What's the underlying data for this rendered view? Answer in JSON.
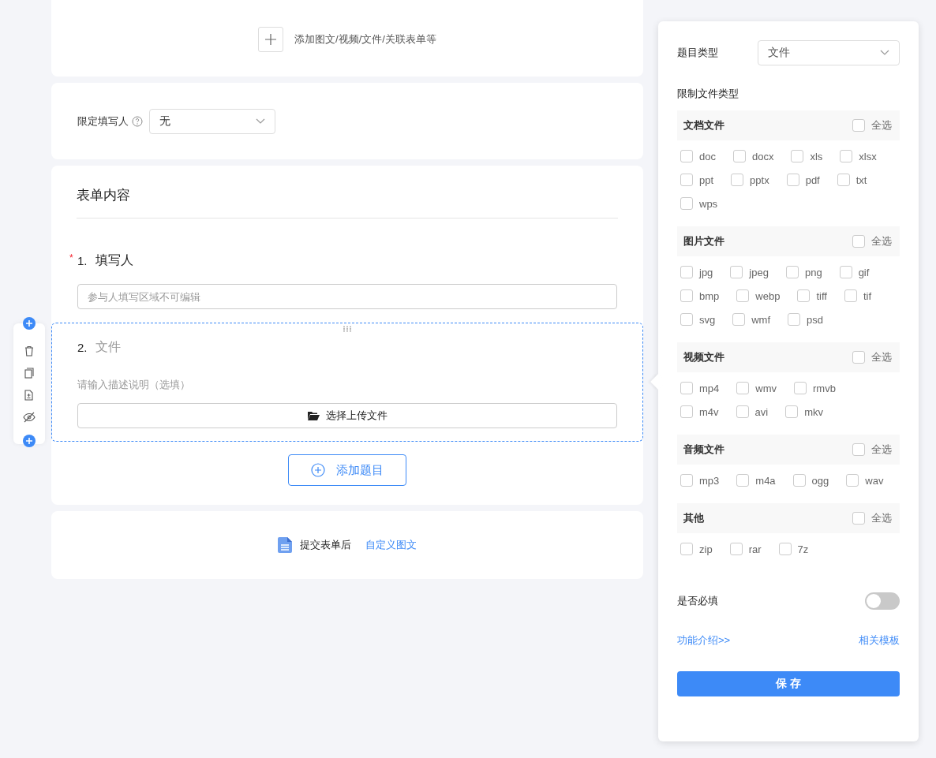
{
  "top_card": {
    "add_label": "添加图文/视频/文件/关联表单等"
  },
  "restrict": {
    "label": "限定填写人",
    "value": "无"
  },
  "form": {
    "title": "表单内容",
    "questions": [
      {
        "kind": "text",
        "number": "1.",
        "title": "填写人",
        "required_mark": "*",
        "placeholder": "参与人填写区域不可编辑",
        "selected": false
      },
      {
        "kind": "file",
        "number": "2.",
        "title": "文件",
        "description": "请输入描述说明（选填）",
        "upload_label": "选择上传文件",
        "selected": true
      }
    ],
    "add_button": "添加题目"
  },
  "after_submit": {
    "label": "提交表单后",
    "link": "自定义图文"
  },
  "panel": {
    "type_label": "题目类型",
    "type_value": "文件",
    "restrict_label": "限制文件类型",
    "groups": [
      {
        "title": "文档文件",
        "all_label": "全选",
        "all_checked": false,
        "items": [
          {
            "label": "doc",
            "checked": false
          },
          {
            "label": "docx",
            "checked": false
          },
          {
            "label": "xls",
            "checked": false
          },
          {
            "label": "xlsx",
            "checked": false
          },
          {
            "label": "ppt",
            "checked": false
          },
          {
            "label": "pptx",
            "checked": false
          },
          {
            "label": "pdf",
            "checked": false
          },
          {
            "label": "txt",
            "checked": false
          },
          {
            "label": "wps",
            "checked": false
          }
        ]
      },
      {
        "title": "图片文件",
        "all_label": "全选",
        "all_checked": false,
        "items": [
          {
            "label": "jpg",
            "checked": false
          },
          {
            "label": "jpeg",
            "checked": false
          },
          {
            "label": "png",
            "checked": false
          },
          {
            "label": "gif",
            "checked": false
          },
          {
            "label": "bmp",
            "checked": false
          },
          {
            "label": "webp",
            "checked": false
          },
          {
            "label": "tiff",
            "checked": false
          },
          {
            "label": "tif",
            "checked": false
          },
          {
            "label": "svg",
            "checked": false
          },
          {
            "label": "wmf",
            "checked": false
          },
          {
            "label": "psd",
            "checked": false
          }
        ]
      },
      {
        "title": "视频文件",
        "all_label": "全选",
        "all_checked": false,
        "items": [
          {
            "label": "mp4",
            "checked": false
          },
          {
            "label": "wmv",
            "checked": false
          },
          {
            "label": "rmvb",
            "checked": false
          },
          {
            "label": "m4v",
            "checked": false
          },
          {
            "label": "avi",
            "checked": false
          },
          {
            "label": "mkv",
            "checked": false
          }
        ]
      },
      {
        "title": "音频文件",
        "all_label": "全选",
        "all_checked": false,
        "items": [
          {
            "label": "mp3",
            "checked": false
          },
          {
            "label": "m4a",
            "checked": false
          },
          {
            "label": "ogg",
            "checked": false
          },
          {
            "label": "wav",
            "checked": false
          }
        ]
      },
      {
        "title": "其他",
        "all_label": "全选",
        "all_checked": false,
        "items": [
          {
            "label": "zip",
            "checked": false
          },
          {
            "label": "rar",
            "checked": false
          },
          {
            "label": "7z",
            "checked": false
          }
        ]
      }
    ],
    "required_label": "是否必填",
    "required_on": false,
    "intro_link": "功能介绍>>",
    "template_link": "相关模板",
    "save": "保 存"
  }
}
